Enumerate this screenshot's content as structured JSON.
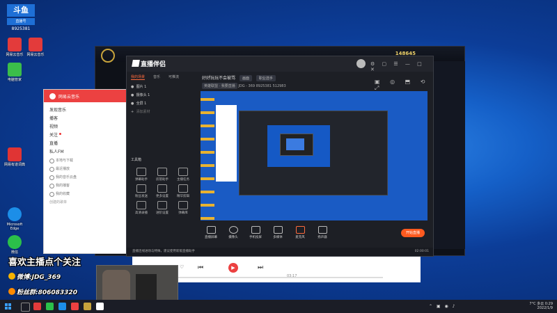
{
  "desktop_badge": {
    "title": "斗鱼",
    "subtitle": "直播号",
    "number": "8925381"
  },
  "desktop_icons": [
    {
      "label": "网易云音乐",
      "color": "#e33b3b"
    },
    {
      "label": "网易云音乐",
      "color": "#e33b3b"
    },
    {
      "label": "电脑管家",
      "color": "#3bbd4a"
    },
    {
      "label": "网易有道词典",
      "color": "#e03434"
    },
    {
      "label": "Microsoft Edge",
      "color": "#1c8ee8"
    },
    {
      "label": "微信",
      "color": "#2bc04a"
    }
  ],
  "game": {
    "coins": "148645"
  },
  "music_app": {
    "brand": "网易云音乐",
    "nav": [
      "发现音乐",
      "播客",
      "视频",
      "关注",
      "直播",
      "私人FM"
    ],
    "my_music": [
      "本地与下载",
      "最近播放",
      "我的音乐云盘",
      "我的播客",
      "我的收藏"
    ],
    "section_label": "创建的歌单"
  },
  "player": {
    "now_playing": "Wolves",
    "artist": "Gomez / Mi...",
    "time": "03:17"
  },
  "live_app": {
    "brand": "直播伴侣",
    "tabs": [
      "我的场景",
      "音乐",
      "可推流"
    ],
    "scenes": [
      "图片 1",
      "摄像头 1",
      "全屏 1",
      "添加素材"
    ],
    "room_title": "好好玩玩不会被骂",
    "room_tag": "画面",
    "room_cat": "职业选手",
    "room_line2_tag": "英雄联盟 · 我要直播",
    "room_id": "JDG - 369",
    "room_num": "8925381",
    "room_fans": "512983",
    "tools_title": "工具箱",
    "tools": [
      "弹幕助手",
      "房管助手",
      "主播任务",
      "粉丝发送",
      "更多设置",
      "精华剪辑",
      "高清录播",
      "进阶设置",
      "弹幕库"
    ],
    "bottom_items": [
      "直播屏幕",
      "摄像头",
      "手机投屏",
      "多媒体",
      "麦克风",
      "扬声器"
    ],
    "start_label": "开始直播",
    "status_text": "直播连线进场与特殊，建议使用新版直播助手",
    "status_time": "02:00:01"
  },
  "overlay": {
    "headline": "喜欢主播点个关注",
    "weibo": "微博:JDG_369",
    "fans_group": "粉丝群:806083320"
  },
  "taskbar": {
    "weather": "7°C 多云",
    "time": "0:29",
    "date": "2022/1/9"
  }
}
